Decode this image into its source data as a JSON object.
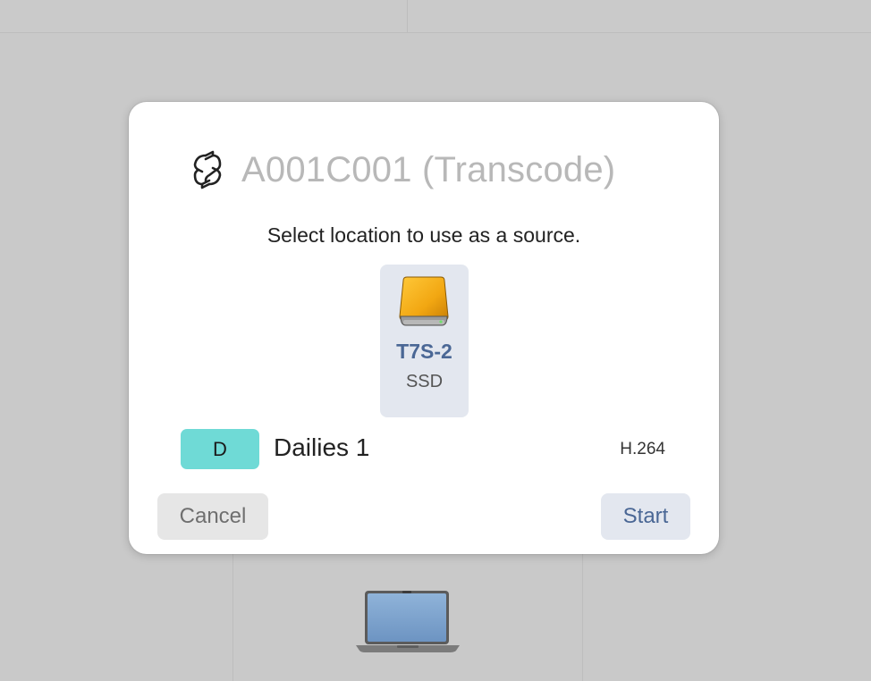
{
  "dialog": {
    "title": "A001C001 (Transcode)",
    "title_icon": "transcode-arrows-icon",
    "prompt": "Select location to use as a source."
  },
  "source": {
    "icon": "external-drive-icon",
    "name": "T7S-2",
    "type": "SSD",
    "selected": true
  },
  "preset": {
    "badge": "D",
    "badge_color": "#6fdad6",
    "name": "Dailies 1",
    "codec": "H.264"
  },
  "actions": {
    "cancel_label": "Cancel",
    "start_label": "Start"
  },
  "background": {
    "device_icon": "laptop-icon"
  },
  "colors": {
    "accent": "#4a6795",
    "selected_tile": "#e3e7ef",
    "drive_orange": "#f2a712"
  }
}
